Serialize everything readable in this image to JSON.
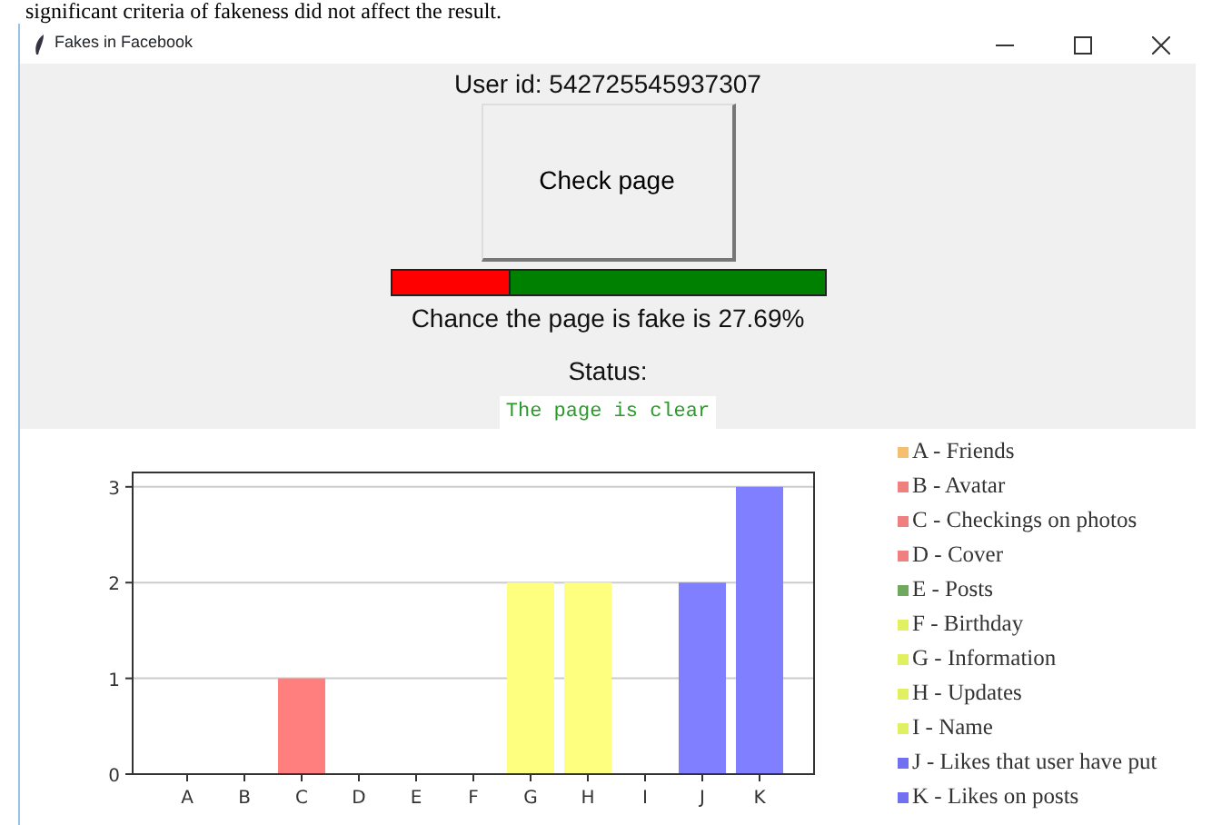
{
  "document_text": "significant criteria of fakeness did not affect the result.",
  "window": {
    "title": "Fakes in Facebook"
  },
  "user_id": "User id: 542725545937307",
  "check_button": "Check page",
  "fake_meter": {
    "level": 0.2769
  },
  "chance_text": "Chance the page is fake is 27.69%",
  "status_label": "Status:",
  "status_value": "The page is clear",
  "chart": {
    "chart_data": {
      "type": "bar",
      "categories": [
        "A",
        "B",
        "C",
        "D",
        "E",
        "F",
        "G",
        "H",
        "I",
        "J",
        "K"
      ],
      "series": [
        {
          "color": "#ff7f7f",
          "values": [
            0,
            0,
            1,
            0,
            0,
            null,
            null,
            null,
            null,
            null,
            null
          ]
        },
        {
          "color": "#ffff7f",
          "values": [
            null,
            null,
            null,
            null,
            null,
            0,
            2,
            2,
            0,
            null,
            null
          ]
        },
        {
          "color": "#7f7fff",
          "values": [
            null,
            null,
            null,
            null,
            null,
            null,
            null,
            null,
            null,
            2,
            3
          ]
        }
      ],
      "grid": true,
      "ylim": [
        0,
        3.15
      ],
      "yticks": [
        0,
        1,
        2,
        3
      ]
    }
  },
  "legend": [
    {
      "label": "A - Friends",
      "color": "#f5bf70"
    },
    {
      "label": "B - Avatar",
      "color": "#f07f80"
    },
    {
      "label": "C - Checkings on photos",
      "color": "#f07f80"
    },
    {
      "label": "D - Cover",
      "color": "#f07f80"
    },
    {
      "label": "E - Posts",
      "color": "#70a860"
    },
    {
      "label": "F - Birthday",
      "color": "#e0f060"
    },
    {
      "label": "G - Information",
      "color": "#e0f060"
    },
    {
      "label": "H - Updates",
      "color": "#e0f060"
    },
    {
      "label": "I - Name",
      "color": "#e0f060"
    },
    {
      "label": "J - Likes that user have put",
      "color": "#7070f0"
    },
    {
      "label": "K - Likes on posts",
      "color": "#7070f0"
    }
  ]
}
